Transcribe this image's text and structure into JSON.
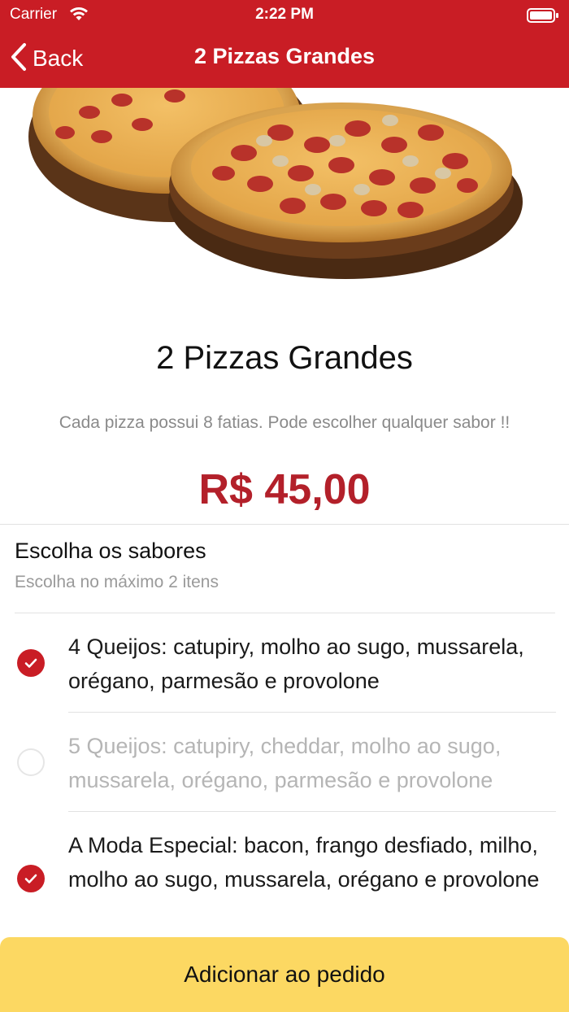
{
  "status_bar": {
    "carrier": "Carrier",
    "time": "2:22 PM"
  },
  "navbar": {
    "back_label": "Back",
    "title": "2 Pizzas Grandes"
  },
  "product": {
    "name": "2 Pizzas Grandes",
    "description": "Cada pizza possui 8 fatias. Pode escolher qualquer sabor !!",
    "price": "R$ 45,00"
  },
  "flavors": {
    "title": "Escolha os sabores",
    "subtitle": "Escolha no máximo 2 itens",
    "options": [
      {
        "label": "4 Queijos: catupiry, molho ao sugo, mussarela, orégano, parmesão e provolone",
        "selected": true
      },
      {
        "label": "5 Queijos: catupiry, cheddar, molho ao sugo, mussarela, orégano, parmesão e provolone",
        "selected": false
      },
      {
        "label": "A Moda Especial: bacon, frango desfiado, milho, molho ao sugo, mussarela, orégano e provolone",
        "selected": true
      }
    ]
  },
  "add_button_label": "Adicionar ao pedido",
  "colors": {
    "brand_red": "#c91d25",
    "price_red": "#b3202a",
    "button_yellow": "#fcd862"
  }
}
